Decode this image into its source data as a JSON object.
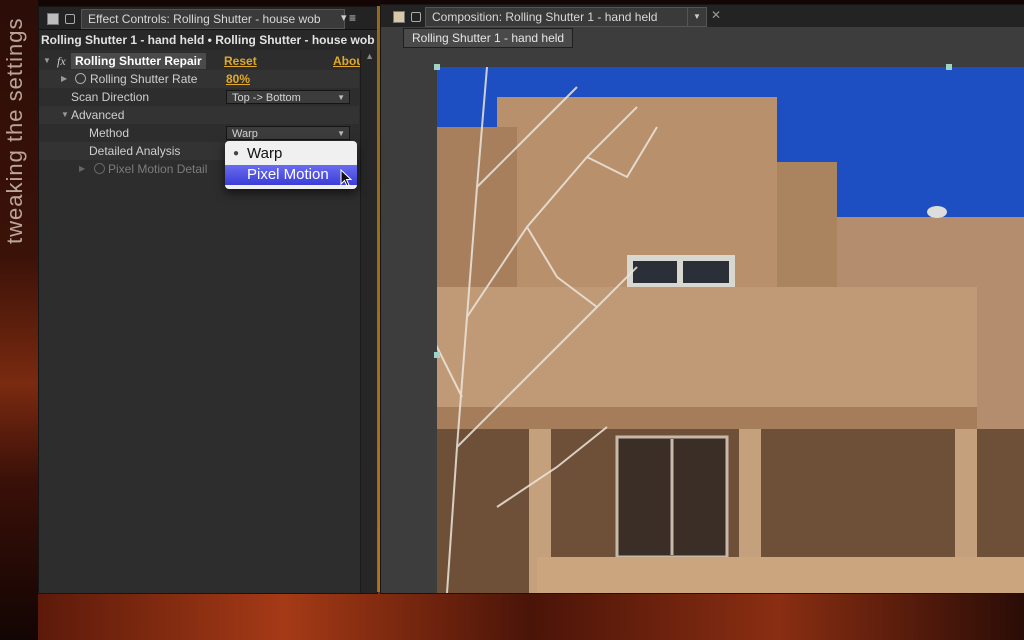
{
  "side_title": "tweaking the settings",
  "effect_controls": {
    "tab_title": "Effect Controls: Rolling Shutter - house wob",
    "subtitle": "Rolling Shutter 1 - hand held • Rolling Shutter - house wob",
    "effect": {
      "fx": "fx",
      "name": "Rolling Shutter Repair",
      "reset": "Reset",
      "about": "About..."
    },
    "properties": [
      {
        "label": "Rolling Shutter Rate",
        "value": "80%"
      },
      {
        "label": "Scan Direction",
        "value": "Top -> Bottom"
      },
      {
        "label": "Advanced"
      },
      {
        "label": "Method",
        "value": "Warp"
      },
      {
        "label": "Detailed Analysis"
      },
      {
        "label": "Pixel Motion Detail"
      }
    ],
    "popup": {
      "items": [
        "Warp",
        "Pixel Motion"
      ],
      "selected_index": 1,
      "checked_index": 0
    }
  },
  "composition": {
    "tab_title": "Composition: Rolling Shutter 1 - hand held",
    "button": "Rolling Shutter 1 - hand held"
  },
  "colors": {
    "accent_yellow": "#e0a92a",
    "menu_highlight": "#4a4ce6",
    "panel_bg": "#2d2d2d"
  }
}
